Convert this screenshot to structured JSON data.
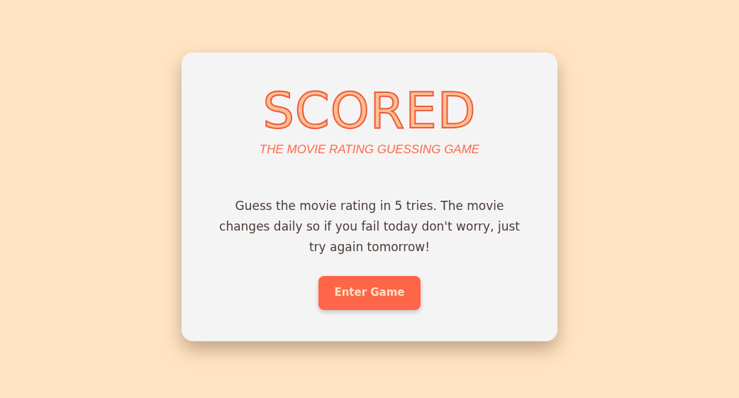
{
  "logo": {
    "title": "SCORED",
    "tagline": "THE MOVIE RATING GUESSING GAME"
  },
  "intro": "Guess the movie rating in 5 tries. The movie changes daily so if you fail today don't worry, just try again tomorrow!",
  "button": {
    "label": "Enter Game"
  }
}
